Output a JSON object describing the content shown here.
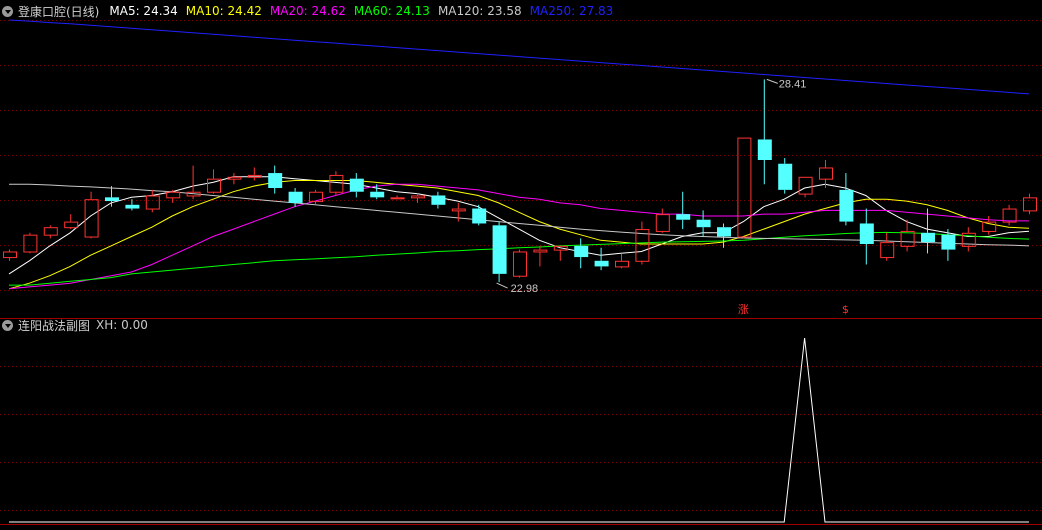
{
  "main_panel": {
    "title": "登康口腔(日线)",
    "ma_legend": [
      {
        "label": "MA5: 24.34",
        "color": "#ffffff"
      },
      {
        "label": "MA10: 24.42",
        "color": "#ffff00"
      },
      {
        "label": "MA20: 24.62",
        "color": "#ff00ff"
      },
      {
        "label": "MA60: 24.13",
        "color": "#00ff00"
      },
      {
        "label": "MA120: 23.58",
        "color": "#c8c8c8"
      },
      {
        "label": "MA250: 27.83",
        "color": "#2020ff"
      }
    ],
    "annotations": {
      "high_label": "28.41",
      "low_label": "22.98",
      "marker_zhang": "涨",
      "marker_s": "$"
    }
  },
  "sub_panel": {
    "title": "连阳战法副图",
    "value_label": "XH: 0.00"
  },
  "colors": {
    "up": "#ff3232",
    "down": "#54ffff",
    "grid": "#800000",
    "axis": "#a00000",
    "ma5": "#ffffff",
    "ma10": "#ffff00",
    "ma20": "#ff00ff",
    "ma60": "#00ff00",
    "ma120": "#c8c8c8",
    "ma250": "#2020ff"
  },
  "chart_data": {
    "type": "candlestick",
    "ylim": [
      22.5,
      30.0
    ],
    "grid": true,
    "ohlc": [
      [
        23.65,
        23.85,
        23.55,
        23.8
      ],
      [
        23.8,
        24.3,
        23.75,
        24.25
      ],
      [
        24.25,
        24.5,
        24.15,
        24.45
      ],
      [
        24.45,
        24.8,
        24.4,
        24.6
      ],
      [
        24.2,
        25.4,
        24.15,
        25.2
      ],
      [
        25.25,
        25.55,
        25.0,
        25.15
      ],
      [
        25.05,
        25.2,
        24.9,
        24.95
      ],
      [
        24.95,
        25.45,
        24.85,
        25.3
      ],
      [
        25.25,
        25.45,
        25.1,
        25.4
      ],
      [
        25.3,
        26.1,
        25.2,
        25.4
      ],
      [
        25.4,
        26.0,
        25.35,
        25.75
      ],
      [
        25.75,
        25.9,
        25.6,
        25.8
      ],
      [
        25.8,
        26.05,
        25.7,
        25.85
      ],
      [
        25.9,
        26.1,
        25.35,
        25.5
      ],
      [
        25.4,
        25.5,
        25.0,
        25.1
      ],
      [
        25.15,
        25.45,
        25.05,
        25.4
      ],
      [
        25.4,
        25.95,
        25.3,
        25.85
      ],
      [
        25.75,
        25.9,
        25.25,
        25.4
      ],
      [
        25.4,
        25.6,
        25.2,
        25.25
      ],
      [
        25.25,
        25.3,
        25.2,
        25.25
      ],
      [
        25.25,
        25.35,
        25.1,
        25.3
      ],
      [
        25.3,
        25.4,
        24.95,
        25.05
      ],
      [
        24.9,
        25.1,
        24.6,
        24.95
      ],
      [
        24.95,
        25.05,
        24.5,
        24.55
      ],
      [
        24.5,
        24.6,
        22.98,
        23.2
      ],
      [
        23.15,
        23.85,
        23.1,
        23.8
      ],
      [
        23.8,
        23.95,
        23.4,
        23.85
      ],
      [
        23.85,
        23.95,
        23.55,
        23.95
      ],
      [
        23.95,
        24.15,
        23.35,
        23.65
      ],
      [
        23.55,
        23.9,
        23.3,
        23.4
      ],
      [
        23.4,
        23.75,
        23.35,
        23.55
      ],
      [
        23.55,
        24.6,
        23.45,
        24.4
      ],
      [
        24.35,
        24.95,
        24.3,
        24.8
      ],
      [
        24.8,
        25.4,
        24.4,
        24.65
      ],
      [
        24.65,
        24.9,
        24.2,
        24.45
      ],
      [
        24.45,
        24.55,
        23.9,
        24.2
      ],
      [
        24.2,
        26.85,
        24.15,
        26.85
      ],
      [
        26.8,
        28.41,
        25.6,
        26.25
      ],
      [
        26.15,
        26.3,
        25.35,
        25.45
      ],
      [
        25.35,
        25.8,
        25.25,
        25.8
      ],
      [
        25.75,
        26.25,
        25.5,
        26.05
      ],
      [
        25.45,
        25.9,
        24.5,
        24.6
      ],
      [
        24.55,
        24.95,
        23.45,
        24.0
      ],
      [
        23.65,
        24.3,
        23.55,
        24.05
      ],
      [
        23.95,
        24.65,
        23.8,
        24.35
      ],
      [
        24.3,
        24.95,
        23.75,
        24.05
      ],
      [
        24.25,
        24.4,
        23.55,
        23.85
      ],
      [
        23.95,
        24.45,
        23.8,
        24.3
      ],
      [
        24.35,
        24.75,
        24.25,
        24.6
      ],
      [
        24.6,
        25.05,
        24.5,
        24.95
      ],
      [
        24.9,
        25.35,
        24.8,
        25.25
      ]
    ],
    "ma_series": [
      {
        "name": "MA5",
        "color_key": "ma5",
        "values": [
          23.2,
          23.55,
          23.95,
          24.3,
          24.75,
          25.1,
          25.25,
          25.3,
          25.4,
          25.55,
          25.65,
          25.8,
          25.8,
          25.8,
          25.75,
          25.7,
          25.65,
          25.6,
          25.5,
          25.4,
          25.35,
          25.25,
          25.15,
          25.0,
          24.7,
          24.4,
          24.1,
          23.9,
          23.8,
          23.7,
          23.75,
          23.8,
          24.0,
          24.2,
          24.3,
          24.3,
          24.6,
          25.0,
          25.2,
          25.5,
          25.6,
          25.5,
          25.3,
          24.9,
          24.6,
          24.4,
          24.3,
          24.2,
          24.2,
          24.3,
          24.34
        ]
      },
      {
        "name": "MA10",
        "color_key": "ma10",
        "values": [
          22.8,
          22.95,
          23.15,
          23.4,
          23.7,
          23.95,
          24.2,
          24.45,
          24.75,
          25.0,
          25.2,
          25.4,
          25.55,
          25.65,
          25.7,
          25.7,
          25.7,
          25.7,
          25.65,
          25.6,
          25.55,
          25.5,
          25.4,
          25.3,
          25.1,
          24.85,
          24.6,
          24.4,
          24.25,
          24.1,
          24.05,
          24.0,
          24.0,
          24.0,
          24.0,
          24.05,
          24.2,
          24.4,
          24.6,
          24.8,
          24.95,
          25.1,
          25.2,
          25.2,
          25.15,
          25.05,
          24.9,
          24.7,
          24.55,
          24.45,
          24.42
        ]
      },
      {
        "name": "MA20",
        "color_key": "ma20",
        "values": [
          22.8,
          22.85,
          22.9,
          22.95,
          23.05,
          23.15,
          23.25,
          23.45,
          23.7,
          23.95,
          24.2,
          24.4,
          24.6,
          24.8,
          25.0,
          25.15,
          25.3,
          25.45,
          25.55,
          25.6,
          25.6,
          25.55,
          25.5,
          25.45,
          25.35,
          25.25,
          25.2,
          25.1,
          25.05,
          24.95,
          24.9,
          24.85,
          24.8,
          24.8,
          24.75,
          24.75,
          24.75,
          24.8,
          24.8,
          24.85,
          24.9,
          24.9,
          24.9,
          24.9,
          24.85,
          24.8,
          24.75,
          24.7,
          24.65,
          24.62,
          24.62
        ]
      },
      {
        "name": "MA60",
        "color_key": "ma60",
        "values": [
          22.9,
          22.9,
          22.95,
          23.0,
          23.05,
          23.1,
          23.2,
          23.25,
          23.3,
          23.35,
          23.4,
          23.45,
          23.5,
          23.55,
          23.58,
          23.6,
          23.63,
          23.66,
          23.7,
          23.73,
          23.76,
          23.8,
          23.82,
          23.85,
          23.87,
          23.9,
          23.92,
          23.95,
          23.97,
          23.99,
          24.01,
          24.03,
          24.05,
          24.06,
          24.07,
          24.08,
          24.1,
          24.14,
          24.18,
          24.22,
          24.25,
          24.28,
          24.3,
          24.31,
          24.3,
          24.28,
          24.25,
          24.22,
          24.18,
          24.15,
          24.13
        ]
      },
      {
        "name": "MA120",
        "color_key": "ma120",
        "values": [
          25.6,
          25.6,
          25.58,
          25.55,
          25.53,
          25.5,
          25.47,
          25.43,
          25.4,
          25.35,
          25.3,
          25.25,
          25.2,
          25.15,
          25.1,
          25.05,
          25.0,
          24.95,
          24.9,
          24.85,
          24.8,
          24.75,
          24.7,
          24.65,
          24.6,
          24.55,
          24.5,
          24.45,
          24.4,
          24.36,
          24.32,
          24.28,
          24.25,
          24.22,
          24.2,
          24.18,
          24.16,
          24.15,
          24.14,
          24.13,
          24.12,
          24.11,
          24.1,
          24.08,
          24.06,
          24.04,
          24.02,
          24.0,
          23.98,
          23.97,
          23.95
        ]
      },
      {
        "name": "MA250",
        "color_key": "ma250",
        "values": [
          30.0,
          29.97,
          29.93,
          29.9,
          29.86,
          29.82,
          29.78,
          29.74,
          29.7,
          29.66,
          29.62,
          29.58,
          29.54,
          29.5,
          29.46,
          29.42,
          29.38,
          29.34,
          29.3,
          29.26,
          29.22,
          29.18,
          29.14,
          29.1,
          29.06,
          29.02,
          28.98,
          28.94,
          28.9,
          28.86,
          28.82,
          28.78,
          28.74,
          28.7,
          28.66,
          28.62,
          28.58,
          28.54,
          28.5,
          28.46,
          28.42,
          28.38,
          28.34,
          28.3,
          28.26,
          28.22,
          28.18,
          28.14,
          28.1,
          28.06,
          28.02
        ]
      }
    ],
    "sub_series": {
      "name": "XH",
      "values": [
        0,
        0,
        0,
        0,
        0,
        0,
        0,
        0,
        0,
        0,
        0,
        0,
        0,
        0,
        0,
        0,
        0,
        0,
        0,
        0,
        0,
        0,
        0,
        0,
        0,
        0,
        0,
        0,
        0,
        0,
        0,
        0,
        0,
        0,
        0,
        0,
        0,
        0,
        0,
        1,
        0,
        0,
        0,
        0,
        0,
        0,
        0,
        0,
        0,
        0,
        0
      ],
      "ylim": [
        0,
        1.0
      ]
    },
    "signals": [
      {
        "bar": 36,
        "text_key": "marker_zhang"
      },
      {
        "bar": 41,
        "text_key": "marker_s"
      }
    ]
  }
}
